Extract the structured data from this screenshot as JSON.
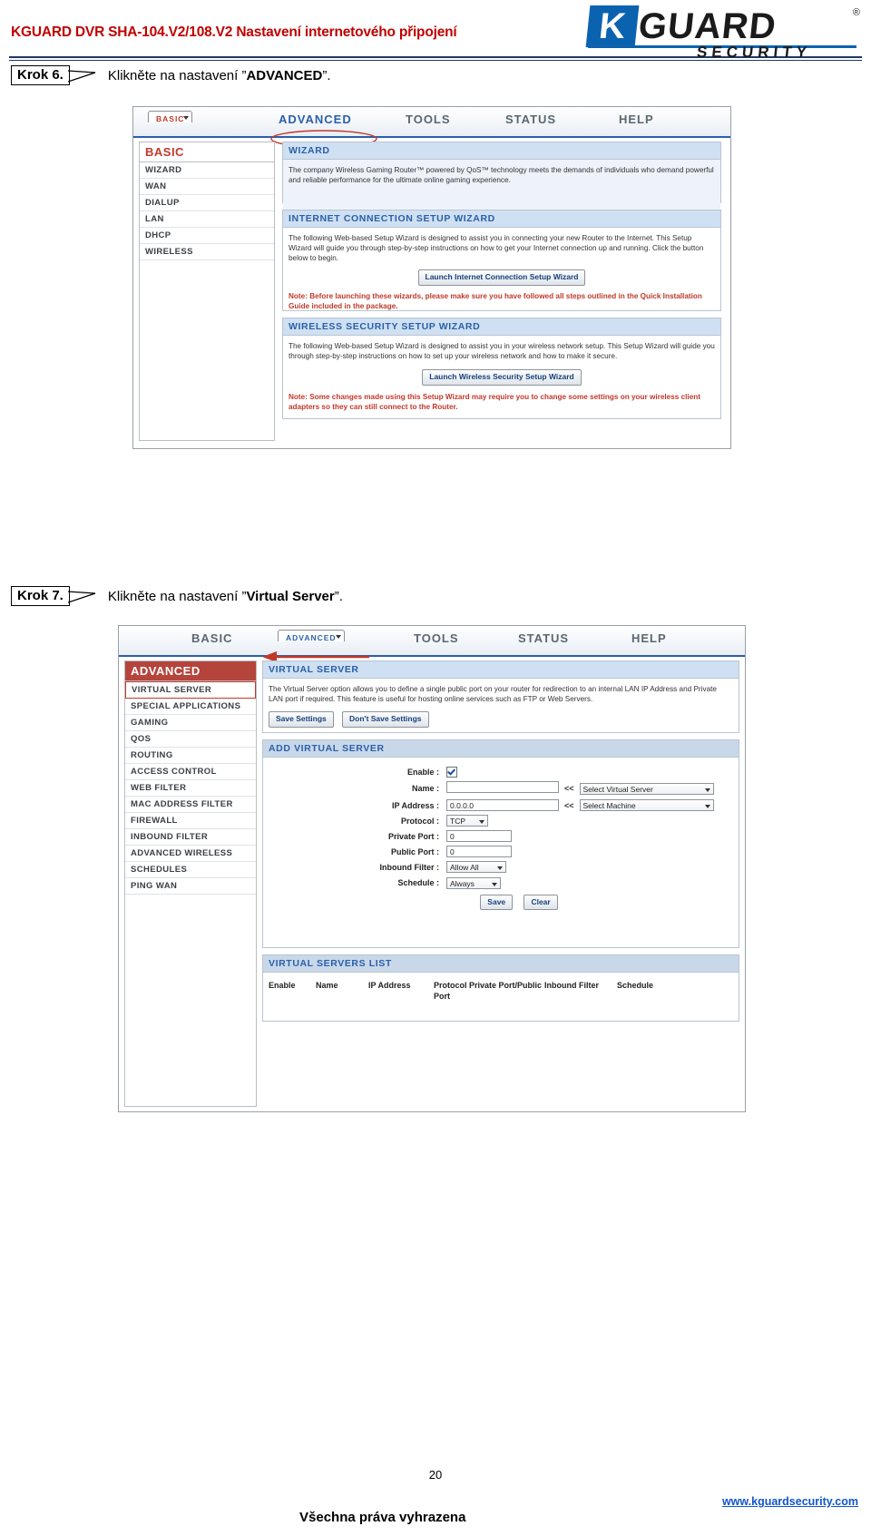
{
  "header": {
    "title": "KGUARD DVR SHA-104.V2/108.V2  Nastavení internetového připojení",
    "logo": {
      "k": "K",
      "guard": "GUARD",
      "security": "SECURITY",
      "reg": "®"
    }
  },
  "steps": [
    {
      "badge": "Krok 6.",
      "text_before": "Klikněte na nastavení ”",
      "text_bold": "ADVANCED",
      "text_after": "”."
    },
    {
      "badge": "Krok 7.",
      "text_before": "Klikněte na nastavení ”",
      "text_bold": "Virtual Server",
      "text_after": "”."
    }
  ],
  "shot1": {
    "nav": [
      "BASIC",
      "ADVANCED",
      "TOOLS",
      "STATUS",
      "HELP"
    ],
    "sidebar": {
      "head": "BASIC",
      "items": [
        "WIZARD",
        "WAN",
        "DIALUP",
        "LAN",
        "DHCP",
        "WIRELESS"
      ]
    },
    "wizard": {
      "title": "WIZARD",
      "body": "The company Wireless Gaming Router™ powered by QoS™ technology meets the demands of individuals who demand powerful and reliable performance for the ultimate online gaming experience."
    },
    "internet_wizard": {
      "title": "INTERNET CONNECTION SETUP WIZARD",
      "body": "The following Web-based Setup Wizard is designed to assist you in connecting your new Router to the Internet. This Setup Wizard will guide you through step-by-step instructions on how to get your Internet connection up and running. Click the button below to begin.",
      "button": "Launch Internet Connection Setup Wizard",
      "note_label": "Note:",
      "note": "Before launching these wizards, please make sure you have followed all steps outlined in the Quick Installation Guide included in the package."
    },
    "wireless_wizard": {
      "title": "WIRELESS SECURITY SETUP WIZARD",
      "body": "The following Web-based Setup Wizard is designed to assist you in your wireless network setup. This Setup Wizard will guide you through step-by-step instructions on how to set up your wireless network and how to make it secure.",
      "button": "Launch Wireless Security Setup Wizard",
      "note_label": "Note:",
      "note": "Some changes made using this Setup Wizard may require you to change some settings on your wireless client adapters so they can still connect to the Router."
    }
  },
  "shot2": {
    "nav": [
      "BASIC",
      "ADVANCED",
      "TOOLS",
      "STATUS",
      "HELP"
    ],
    "sidebar": {
      "head": "ADVANCED",
      "items": [
        "VIRTUAL SERVER",
        "SPECIAL APPLICATIONS",
        "GAMING",
        "QOS",
        "ROUTING",
        "ACCESS CONTROL",
        "WEB FILTER",
        "MAC ADDRESS FILTER",
        "FIREWALL",
        "INBOUND FILTER",
        "ADVANCED WIRELESS",
        "SCHEDULES",
        "PING WAN"
      ],
      "highlighted": "VIRTUAL SERVER"
    },
    "virtual_server": {
      "title": "VIRTUAL SERVER",
      "body": "The Virtual Server option allows you to define a single public port on your router for redirection to an internal LAN IP Address and Private LAN port if required. This feature is useful for hosting online services such as FTP or Web Servers.",
      "save_button": "Save Settings",
      "dont_save_button": "Don't Save Settings"
    },
    "add_virtual_server": {
      "title": "ADD VIRTUAL SERVER",
      "fields": [
        {
          "label": "Enable :",
          "type": "checkbox",
          "value": "checked"
        },
        {
          "label": "Name :",
          "type": "text",
          "value": "",
          "arrows": "<<",
          "select": "Select Virtual Server"
        },
        {
          "label": "IP Address :",
          "type": "text",
          "value": "0.0.0.0",
          "arrows": "<<",
          "select": "Select Machine"
        },
        {
          "label": "Protocol :",
          "type": "select",
          "value": "TCP"
        },
        {
          "label": "Private Port :",
          "type": "text",
          "value": "0"
        },
        {
          "label": "Public Port :",
          "type": "text",
          "value": "0"
        },
        {
          "label": "Inbound Filter :",
          "type": "select",
          "value": "Allow All"
        },
        {
          "label": "Schedule :",
          "type": "select",
          "value": "Always"
        }
      ],
      "save_button": "Save",
      "clear_button": "Clear"
    },
    "virtual_servers_list": {
      "title": "VIRTUAL SERVERS LIST",
      "columns": [
        "Enable",
        "Name",
        "IP Address",
        "Protocol Private Port/Public Port",
        "Inbound Filter",
        "Schedule"
      ]
    }
  },
  "footer": {
    "page_number": "20",
    "rights": "Všechna práva vyhrazena",
    "website": "www.kguardsecurity.com"
  }
}
